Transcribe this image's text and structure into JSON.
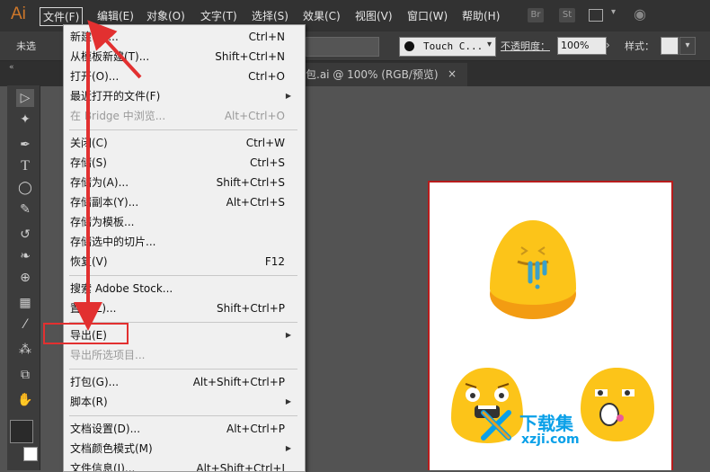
{
  "menubar": {
    "logo": "Ai",
    "items": [
      {
        "label": "文件(F)"
      },
      {
        "label": "编辑(E)"
      },
      {
        "label": "对象(O)"
      },
      {
        "label": "文字(T)"
      },
      {
        "label": "选择(S)"
      },
      {
        "label": "效果(C)"
      },
      {
        "label": "视图(V)"
      },
      {
        "label": "窗口(W)"
      },
      {
        "label": "帮助(H)"
      }
    ],
    "right_badges": [
      "Br",
      "St"
    ]
  },
  "control_bar": {
    "left_label": "未选",
    "brush_name": "Touch C...",
    "opacity_label": "不透明度：",
    "opacity_value": "100%",
    "style_label": "样式："
  },
  "document_tab": {
    "title": "包.ai @ 100% (RGB/预览)",
    "close": "×"
  },
  "file_menu": {
    "items": [
      {
        "label": "新建(N)...",
        "shortcut": "Ctrl+N",
        "disabled": false
      },
      {
        "label": "从模板新建(T)...",
        "shortcut": "Shift+Ctrl+N",
        "disabled": false
      },
      {
        "label": "打开(O)...",
        "shortcut": "Ctrl+O",
        "disabled": false
      },
      {
        "label": "最近打开的文件(F)",
        "shortcut": "",
        "disabled": false,
        "submenu": true
      },
      {
        "label": "在 Bridge 中浏览...",
        "shortcut": "Alt+Ctrl+O",
        "disabled": true
      },
      {
        "label": "关闭(C)",
        "shortcut": "Ctrl+W",
        "disabled": false
      },
      {
        "label": "存储(S)",
        "shortcut": "Ctrl+S",
        "disabled": false
      },
      {
        "label": "存储为(A)...",
        "shortcut": "Shift+Ctrl+S",
        "disabled": false
      },
      {
        "label": "存储副本(Y)...",
        "shortcut": "Alt+Ctrl+S",
        "disabled": false
      },
      {
        "label": "存储为模板...",
        "shortcut": "",
        "disabled": false
      },
      {
        "label": "存储选中的切片...",
        "shortcut": "",
        "disabled": false
      },
      {
        "label": "恢复(V)",
        "shortcut": "F12",
        "disabled": false
      },
      {
        "label": "搜索 Adobe Stock...",
        "shortcut": "",
        "disabled": false
      },
      {
        "label": "置入(L)...",
        "shortcut": "Shift+Ctrl+P",
        "disabled": false
      },
      {
        "label": "导出(E)",
        "shortcut": "",
        "disabled": false,
        "submenu": true
      },
      {
        "label": "导出所选项目...",
        "shortcut": "",
        "disabled": true
      },
      {
        "label": "打包(G)...",
        "shortcut": "Alt+Shift+Ctrl+P",
        "disabled": false
      },
      {
        "label": "脚本(R)",
        "shortcut": "",
        "disabled": false,
        "submenu": true
      },
      {
        "label": "文档设置(D)...",
        "shortcut": "Alt+Ctrl+P",
        "disabled": false
      },
      {
        "label": "文档颜色模式(M)",
        "shortcut": "",
        "disabled": false,
        "submenu": true
      },
      {
        "label": "文件信息(I)...",
        "shortcut": "Alt+Shift+Ctrl+I",
        "disabled": false
      }
    ]
  },
  "watermark": {
    "line1": "下载集",
    "line2": "xzji.com"
  },
  "colors": {
    "accent_red": "#e23030",
    "emoji_yellow": "#fcc419",
    "emoji_shadow": "#f39c12",
    "watermark_blue": "#0aa0e8"
  }
}
